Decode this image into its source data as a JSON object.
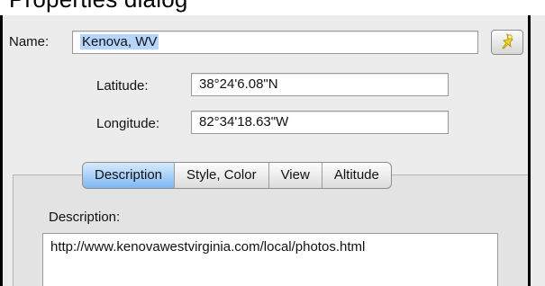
{
  "header": {
    "title": "Properties dialog"
  },
  "form": {
    "name_label": "Name:",
    "name_value": "Kenova, WV",
    "latitude_label": "Latitude:",
    "latitude_value": "38°24'6.08\"N",
    "longitude_label": "Longitude:",
    "longitude_value": "82°34'18.63\"W"
  },
  "toolbar": {
    "pin_icon": "pushpin-icon"
  },
  "tabs": [
    {
      "label": "Description",
      "active": true
    },
    {
      "label": "Style, Color",
      "active": false
    },
    {
      "label": "View",
      "active": false
    },
    {
      "label": "Altitude",
      "active": false
    }
  ],
  "description": {
    "label": "Description:",
    "text": "http://www.kenovawestvirginia.com/local/photos.html"
  },
  "colors": {
    "selection": "#b5d5ff",
    "active_tab": "#7db7f3",
    "pin": "#f2d629"
  }
}
